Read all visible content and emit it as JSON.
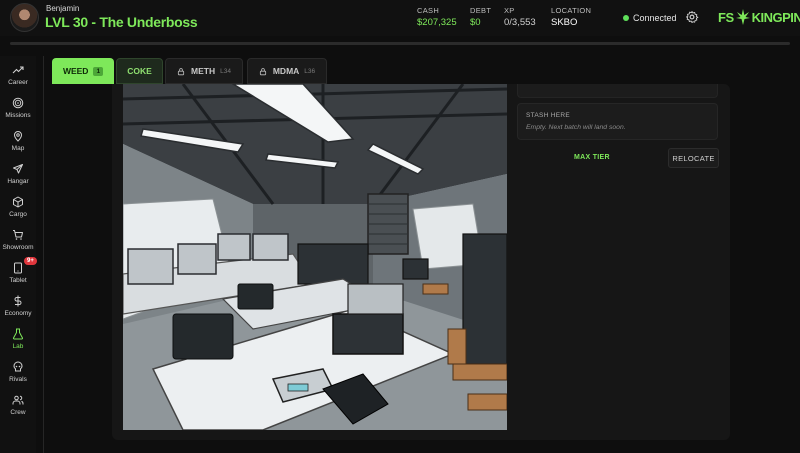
{
  "header": {
    "username": "Benjamin",
    "level_title": "LVL 30 - The Underboss",
    "stats": [
      {
        "label": "CASH",
        "value": "$207,325",
        "color": "#7ee85a"
      },
      {
        "label": "DEBT",
        "value": "$0",
        "color": "#7ee85a"
      },
      {
        "label": "XP",
        "value": "0/3,553",
        "color": "#d0d0d0"
      },
      {
        "label": "LOCATION",
        "value": "SKBO",
        "color": "#ffffff"
      }
    ],
    "connection_status": "Connected",
    "logo": {
      "left": "FS",
      "right": "KINGPIN"
    },
    "xp_progress_fraction": 0
  },
  "sidebar": {
    "items": [
      {
        "label": "Career",
        "icon": "trending-up-icon"
      },
      {
        "label": "Missions",
        "icon": "target-icon"
      },
      {
        "label": "Map",
        "icon": "map-pin-icon"
      },
      {
        "label": "Hangar",
        "icon": "plane-icon"
      },
      {
        "label": "Cargo",
        "icon": "box-icon"
      },
      {
        "label": "Showroom",
        "icon": "cart-icon"
      },
      {
        "label": "Tablet",
        "icon": "tablet-icon",
        "badge": "9+"
      },
      {
        "label": "Economy",
        "icon": "dollar-icon"
      },
      {
        "label": "Lab",
        "icon": "flask-icon",
        "active": true
      },
      {
        "label": "Rivals",
        "icon": "skull-icon"
      },
      {
        "label": "Crew",
        "icon": "users-icon"
      }
    ]
  },
  "tabs": {
    "weed": {
      "label": "WEED",
      "level": "1"
    },
    "coke": {
      "label": "COKE"
    },
    "meth": {
      "label": "METH",
      "level": "L34"
    },
    "mdma": {
      "label": "MDMA",
      "level": "L36"
    }
  },
  "stash": {
    "title": "STASH HERE",
    "text": "Empty. Next batch will land soon."
  },
  "actions": {
    "max_tier": "MAX TIER",
    "relocate": "RELOCATE"
  },
  "colors": {
    "accent": "#7ee85a",
    "badge": "#e0363c"
  }
}
